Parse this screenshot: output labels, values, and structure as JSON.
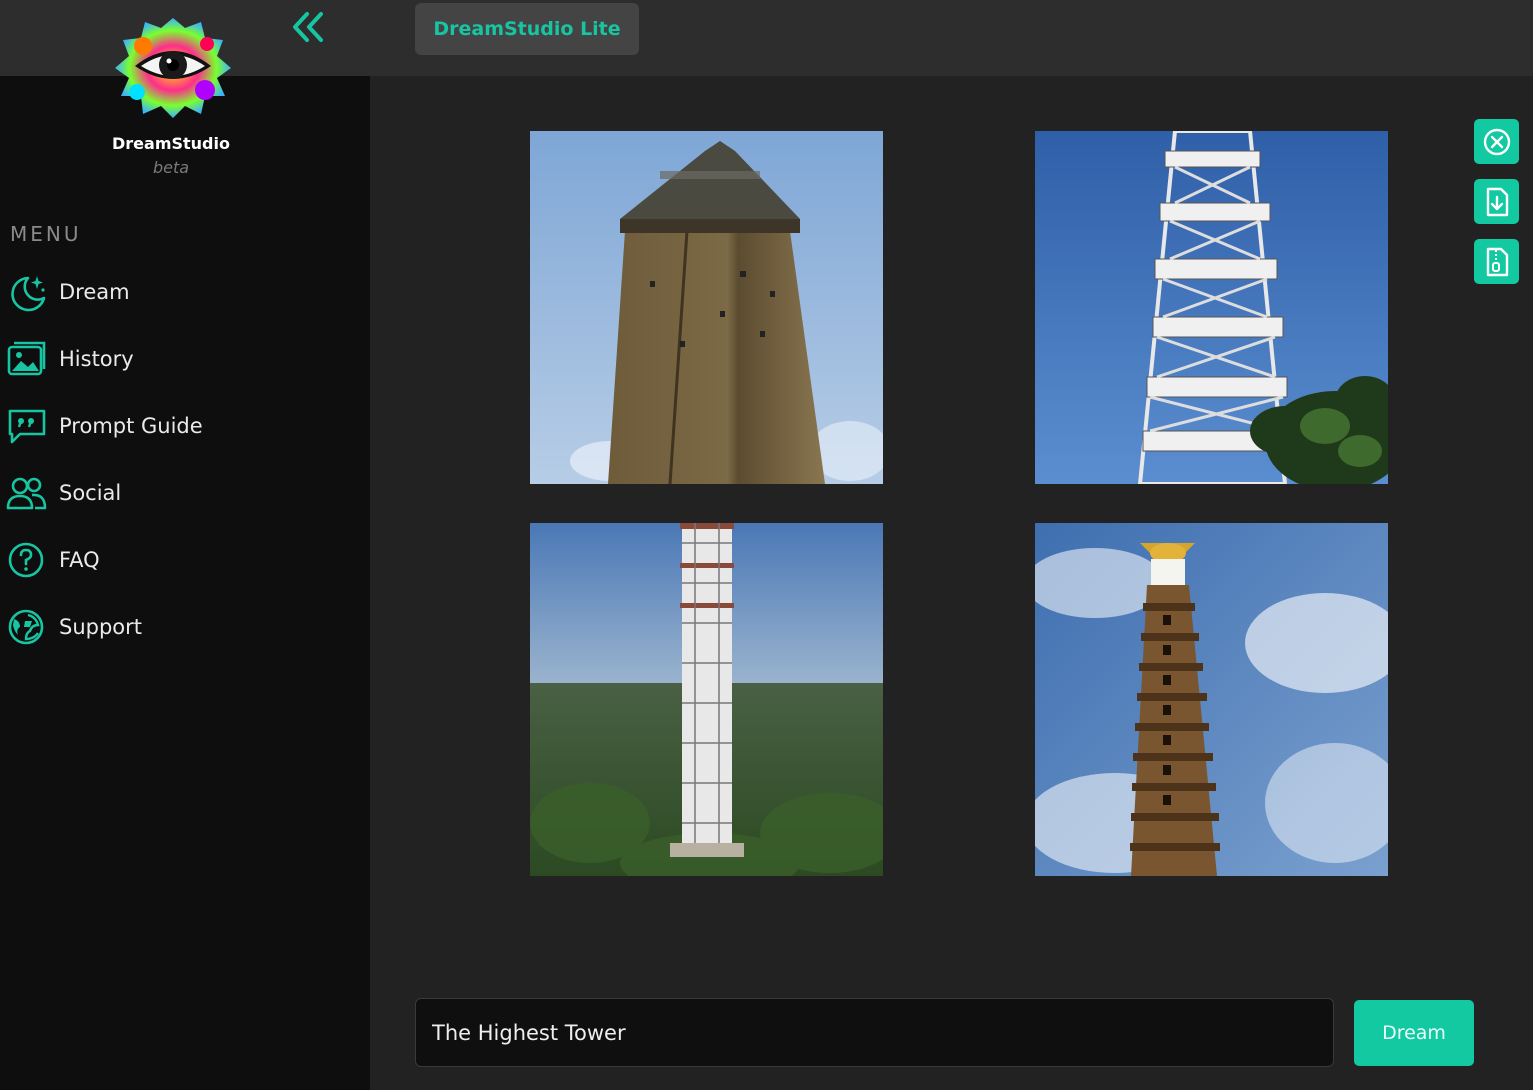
{
  "app": {
    "brand": "DreamStudio",
    "brand_sub": "beta",
    "page_title": "DreamStudio Lite"
  },
  "sidebar": {
    "menu_heading": "MENU",
    "items": [
      {
        "label": "Dream",
        "icon": "moon-sparkle-icon"
      },
      {
        "label": "History",
        "icon": "gallery-icon"
      },
      {
        "label": "Prompt Guide",
        "icon": "quote-bubble-icon"
      },
      {
        "label": "Social",
        "icon": "users-icon"
      },
      {
        "label": "FAQ",
        "icon": "question-circle-icon"
      },
      {
        "label": "Support",
        "icon": "globe-support-icon"
      }
    ]
  },
  "gallery": {
    "images": [
      {
        "subject": "stone-tower"
      },
      {
        "subject": "white-lattice-tower"
      },
      {
        "subject": "tall-white-tower-forest"
      },
      {
        "subject": "lighthouse-tower"
      }
    ]
  },
  "actions": [
    {
      "name": "close-icon"
    },
    {
      "name": "download-icon"
    },
    {
      "name": "zip-file-icon"
    }
  ],
  "prompt": {
    "value": "The Highest Tower",
    "submit_label": "Dream"
  },
  "colors": {
    "accent": "#12c9a2",
    "sidebar_bg": "#0e0e0e",
    "main_bg": "#222222",
    "topbar_bg": "#2d2d2d"
  }
}
